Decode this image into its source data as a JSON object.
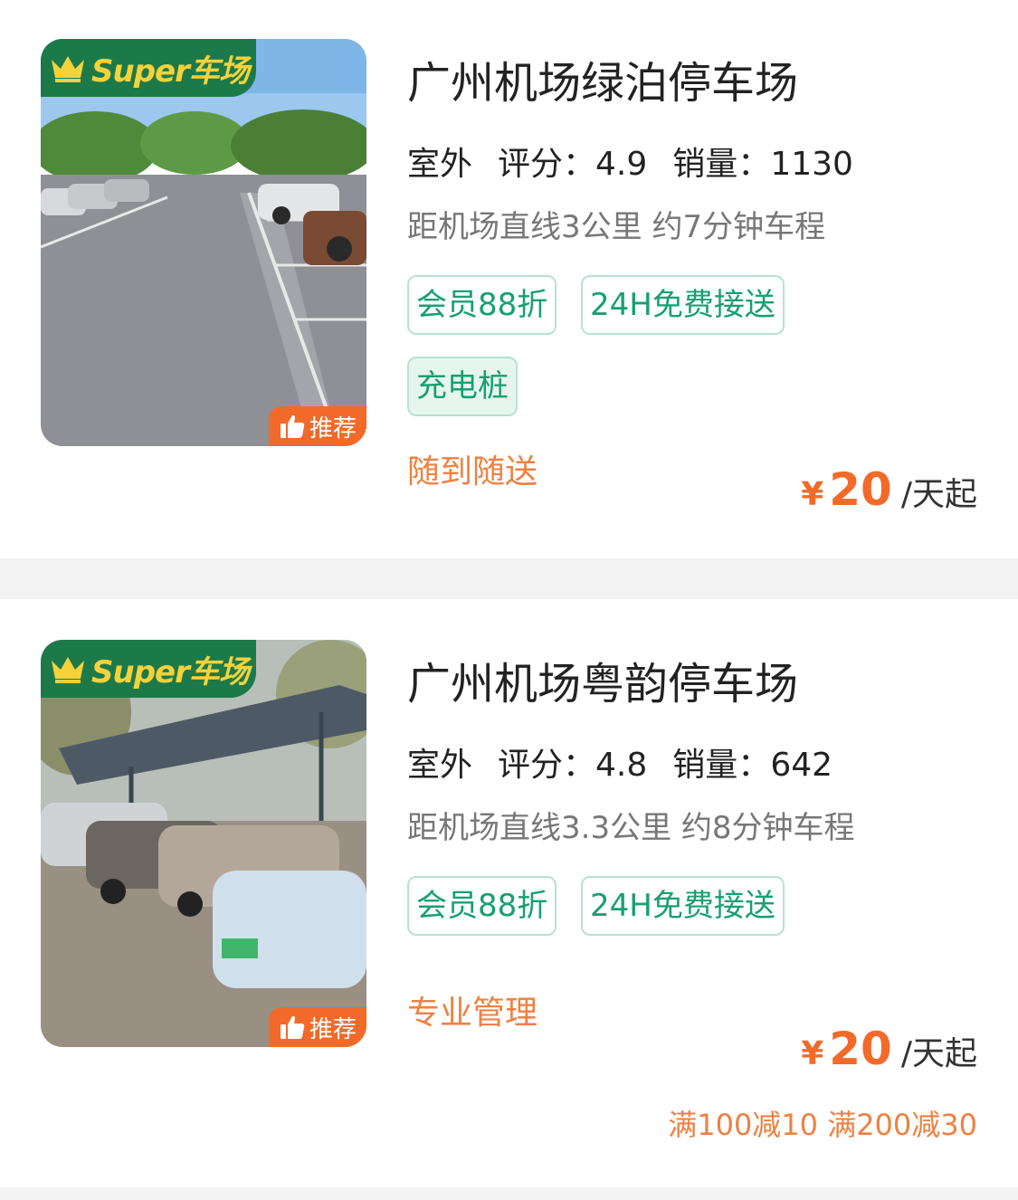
{
  "colors": {
    "accent_green": "#17a070",
    "tag_border": "#b5e3d1",
    "price_orange": "#f26a2a",
    "note_orange": "#f08040",
    "badge_green": "#1c7a4a",
    "badge_yellow": "#f5d23a"
  },
  "listings": [
    {
      "super_badge": "Super车场",
      "recommend_badge": "推荐",
      "title": "广州机场绿泊停车场",
      "env": "室外",
      "rating_label": "评分：",
      "rating": "4.9",
      "sales_label": "销量：",
      "sales": "1130",
      "distance": "距机场直线3公里 约7分钟车程",
      "tags": [
        "会员88折",
        "24H免费接送",
        "充电桩"
      ],
      "note": "随到随送",
      "price_currency": "¥",
      "price": "20",
      "price_unit": "/天起",
      "promo": ""
    },
    {
      "super_badge": "Super车场",
      "recommend_badge": "推荐",
      "title": "广州机场粤韵停车场",
      "env": "室外",
      "rating_label": "评分：",
      "rating": "4.8",
      "sales_label": "销量：",
      "sales": "642",
      "distance": "距机场直线3.3公里 约8分钟车程",
      "tags": [
        "会员88折",
        "24H免费接送"
      ],
      "note": "专业管理",
      "price_currency": "¥",
      "price": "20",
      "price_unit": "/天起",
      "promo": "满100减10 满200减30"
    }
  ]
}
